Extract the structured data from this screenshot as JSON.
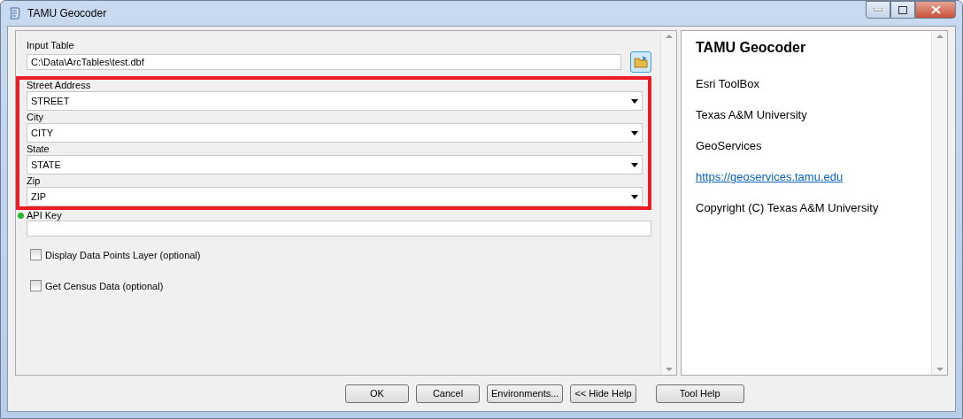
{
  "window": {
    "title": "TAMU Geocoder"
  },
  "input_table": {
    "label": "Input Table",
    "value": "C:\\Data\\ArcTables\\test.dbf"
  },
  "highlighted_fields": [
    {
      "kind": "dropdown",
      "label": "Street Address",
      "value": "STREET"
    },
    {
      "kind": "dropdown",
      "label": "City",
      "value": "CITY"
    },
    {
      "kind": "dropdown",
      "label": "State",
      "value": "STATE"
    },
    {
      "kind": "dropdown",
      "label": "Zip",
      "value": "ZIP"
    }
  ],
  "api_key": {
    "label": "API Key"
  },
  "checkboxes": [
    {
      "label": "Display Data Points Layer (optional)",
      "checked": false
    },
    {
      "label": "Get Census Data (optional)",
      "checked": false
    }
  ],
  "help": {
    "title": "TAMU Geocoder",
    "items": [
      {
        "kind": "text",
        "text": "Esri ToolBox"
      },
      {
        "kind": "text",
        "text": "Texas A&M University"
      },
      {
        "kind": "text",
        "text": "GeoServices"
      },
      {
        "kind": "link",
        "text": "https://geoservices.tamu.edu"
      },
      {
        "kind": "text",
        "text": "Copyright (C) Texas A&M University"
      }
    ]
  },
  "buttons": [
    {
      "label": "OK",
      "kind": "action"
    },
    {
      "label": "Cancel",
      "kind": "action"
    },
    {
      "label": "Environments...",
      "kind": "action"
    },
    {
      "label": "<< Hide Help",
      "kind": "action"
    },
    {
      "label": "Tool Help",
      "kind": "help"
    }
  ]
}
